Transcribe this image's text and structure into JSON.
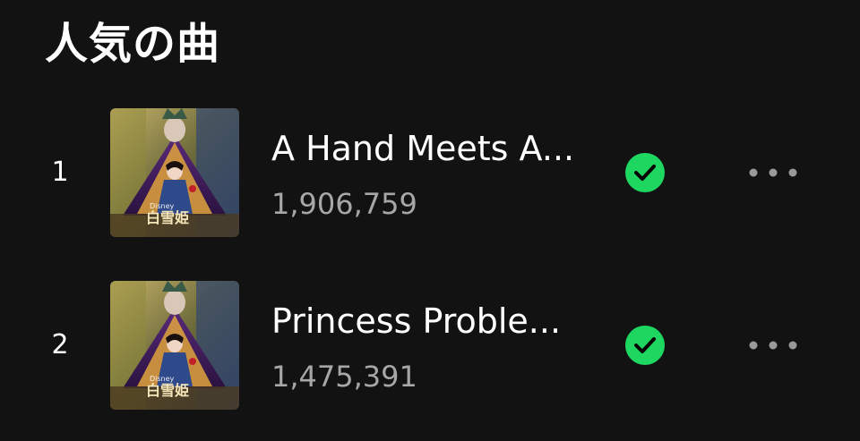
{
  "section": {
    "title": "人気の曲"
  },
  "colors": {
    "background": "#121212",
    "text_primary": "#ffffff",
    "text_secondary": "#a7a7a7",
    "accent_check": "#1ed760",
    "more_dots": "#9a9a9a"
  },
  "artwork": {
    "title_text": "白雪姫",
    "brand_text": "Disney"
  },
  "tracks": [
    {
      "rank": "1",
      "title": "A Hand Meets A...",
      "plays": "1,906,759",
      "downloaded_icon": "check-circle-icon",
      "more_icon": "ellipsis-icon"
    },
    {
      "rank": "2",
      "title": "Princess Proble...",
      "plays": "1,475,391",
      "downloaded_icon": "check-circle-icon",
      "more_icon": "ellipsis-icon"
    }
  ]
}
